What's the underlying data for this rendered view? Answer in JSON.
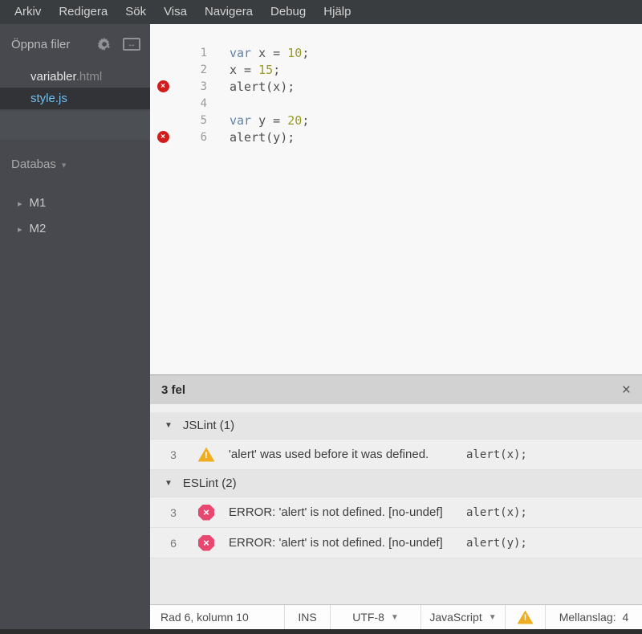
{
  "colors": {
    "selected_file": "#6fc0f0",
    "gutter_error": "#d21c1c",
    "panel_error": "#e8486f",
    "warning": "#f0ad1f",
    "keyword": "#6183ab",
    "number": "#9a9b1f"
  },
  "menubar": {
    "items": [
      "Arkiv",
      "Redigera",
      "Sök",
      "Visa",
      "Navigera",
      "Debug",
      "Hjälp"
    ]
  },
  "sidebar": {
    "open_files_title": "Öppna filer",
    "gear_icon": "gear-icon",
    "split_view_icon": "split-view-icon",
    "split_glyph": "↔",
    "files": [
      {
        "base": "variabler",
        "ext": ".html",
        "selected": false
      },
      {
        "base": "style.js",
        "ext": "",
        "selected": true
      }
    ],
    "project_name": "Databas",
    "project_caret": "▾",
    "tree_collapse_glyph": "▸",
    "tree": [
      {
        "label": "M1"
      },
      {
        "label": "M2"
      }
    ]
  },
  "editor": {
    "error_glyph": "×",
    "lines": [
      {
        "n": "1",
        "error": false,
        "tokens": [
          [
            "var",
            "kw"
          ],
          [
            " x = ",
            "pl"
          ],
          [
            "10",
            "num"
          ],
          [
            ";",
            "pl"
          ]
        ]
      },
      {
        "n": "2",
        "error": false,
        "tokens": [
          [
            "x = ",
            "pl"
          ],
          [
            "15",
            "num"
          ],
          [
            ";",
            "pl"
          ]
        ]
      },
      {
        "n": "3",
        "error": true,
        "tokens": [
          [
            "alert(x);",
            "pl"
          ]
        ]
      },
      {
        "n": "4",
        "error": false,
        "tokens": []
      },
      {
        "n": "5",
        "error": false,
        "tokens": [
          [
            "var",
            "kw"
          ],
          [
            " y = ",
            "pl"
          ],
          [
            "20",
            "num"
          ],
          [
            ";",
            "pl"
          ]
        ]
      },
      {
        "n": "6",
        "error": true,
        "tokens": [
          [
            "alert(y);",
            "pl"
          ]
        ]
      }
    ]
  },
  "panel": {
    "title": "3 fel",
    "close": "×",
    "section_caret": "▼",
    "error_glyph": "×",
    "sections": [
      {
        "label": "JSLint (1)",
        "rows": [
          {
            "line": "3",
            "severity": "warning",
            "message": "'alert' was used before it was defined.",
            "code": "alert(x);"
          }
        ]
      },
      {
        "label": "ESLint (2)",
        "rows": [
          {
            "line": "3",
            "severity": "error",
            "message": "ERROR: 'alert' is not defined. [no-undef]",
            "code": "alert(x);"
          },
          {
            "line": "6",
            "severity": "error",
            "message": "ERROR: 'alert' is not defined. [no-undef]",
            "code": "alert(y);"
          }
        ]
      }
    ]
  },
  "statusbar": {
    "cursor": "Rad 6, kolumn 10",
    "insert_mode": "INS",
    "encoding": "UTF-8",
    "language": "JavaScript",
    "dropdown_caret": "▼",
    "indent_label": "Mellanslag:",
    "indent_value": "4"
  }
}
